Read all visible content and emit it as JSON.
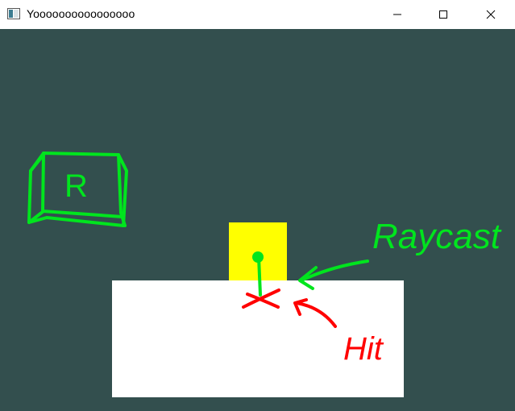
{
  "window": {
    "title": "Yoooooooooooooooo",
    "icon": "app-window-icon"
  },
  "controls": {
    "minimize_icon": "minimize-icon",
    "maximize_icon": "maximize-icon",
    "close_icon": "close-icon"
  },
  "scene": {
    "background_color": "#334f4e",
    "ground_color": "#ffffff",
    "player_color": "#ffff00",
    "key_hint": "R",
    "raycast_label": "Raycast",
    "hit_label": "Hit",
    "sketch_green": "#00e51e",
    "sketch_red": "#ff0000"
  }
}
